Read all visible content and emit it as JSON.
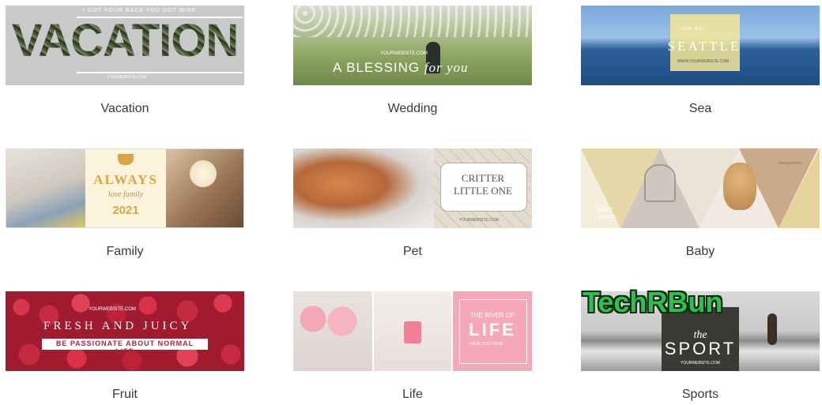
{
  "templates": [
    {
      "label": "Vacation",
      "thumb_text": {
        "headline": "VACATION",
        "tagline": "I GOT YOUR BACK YOU GOT MINE",
        "url": "YOURWEBSITE.COM"
      }
    },
    {
      "label": "Wedding",
      "thumb_text": {
        "headline": "A BLESSING",
        "script": "for you",
        "url": "YOURWEBSITE.COM"
      }
    },
    {
      "label": "Sea",
      "thumb_text": {
        "headline": "SEATTLE",
        "top": "YOUR TEXT",
        "url": "WWW.YOURWEBSITE.COM"
      }
    },
    {
      "label": "Family",
      "thumb_text": {
        "headline": "ALWAYS",
        "subline": "love family",
        "year": "2021"
      }
    },
    {
      "label": "Pet",
      "thumb_text": {
        "line1": "CRITTER",
        "line2": "LITTLE ONE",
        "url": "YOURWEBSITE.COM"
      }
    },
    {
      "label": "Baby",
      "thumb_text": {
        "name_line1": "BABY",
        "name_line2": "ANGEL",
        "corner": "Imagination"
      }
    },
    {
      "label": "Fruit",
      "thumb_text": {
        "top": "YOURWEBSITE.COM",
        "headline": "FRESH AND JUICY",
        "banner": "BE PASSIONATE ABOUT NORMAL LIFE"
      }
    },
    {
      "label": "Life",
      "thumb_text": {
        "top": "THE RIVER OF",
        "headline": "LIFE",
        "lines": "YOUR TEXT HERE"
      }
    },
    {
      "label": "Sports",
      "thumb_text": {
        "the": "the",
        "headline": "SPORT",
        "url": "YOURWEBSITE.COM"
      }
    }
  ],
  "watermark": "TechRBun"
}
